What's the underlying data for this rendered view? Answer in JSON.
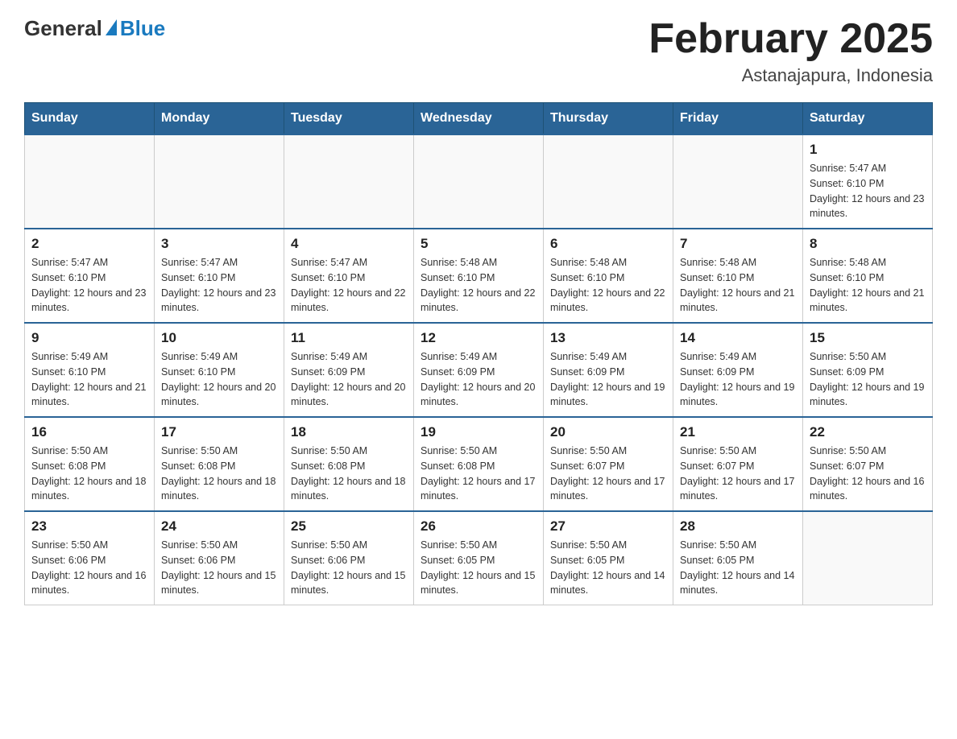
{
  "header": {
    "logo_general": "General",
    "logo_blue": "Blue",
    "title": "February 2025",
    "subtitle": "Astanajapura, Indonesia"
  },
  "weekdays": [
    "Sunday",
    "Monday",
    "Tuesday",
    "Wednesday",
    "Thursday",
    "Friday",
    "Saturday"
  ],
  "weeks": [
    [
      {
        "day": "",
        "sunrise": "",
        "sunset": "",
        "daylight": ""
      },
      {
        "day": "",
        "sunrise": "",
        "sunset": "",
        "daylight": ""
      },
      {
        "day": "",
        "sunrise": "",
        "sunset": "",
        "daylight": ""
      },
      {
        "day": "",
        "sunrise": "",
        "sunset": "",
        "daylight": ""
      },
      {
        "day": "",
        "sunrise": "",
        "sunset": "",
        "daylight": ""
      },
      {
        "day": "",
        "sunrise": "",
        "sunset": "",
        "daylight": ""
      },
      {
        "day": "1",
        "sunrise": "Sunrise: 5:47 AM",
        "sunset": "Sunset: 6:10 PM",
        "daylight": "Daylight: 12 hours and 23 minutes."
      }
    ],
    [
      {
        "day": "2",
        "sunrise": "Sunrise: 5:47 AM",
        "sunset": "Sunset: 6:10 PM",
        "daylight": "Daylight: 12 hours and 23 minutes."
      },
      {
        "day": "3",
        "sunrise": "Sunrise: 5:47 AM",
        "sunset": "Sunset: 6:10 PM",
        "daylight": "Daylight: 12 hours and 23 minutes."
      },
      {
        "day": "4",
        "sunrise": "Sunrise: 5:47 AM",
        "sunset": "Sunset: 6:10 PM",
        "daylight": "Daylight: 12 hours and 22 minutes."
      },
      {
        "day": "5",
        "sunrise": "Sunrise: 5:48 AM",
        "sunset": "Sunset: 6:10 PM",
        "daylight": "Daylight: 12 hours and 22 minutes."
      },
      {
        "day": "6",
        "sunrise": "Sunrise: 5:48 AM",
        "sunset": "Sunset: 6:10 PM",
        "daylight": "Daylight: 12 hours and 22 minutes."
      },
      {
        "day": "7",
        "sunrise": "Sunrise: 5:48 AM",
        "sunset": "Sunset: 6:10 PM",
        "daylight": "Daylight: 12 hours and 21 minutes."
      },
      {
        "day": "8",
        "sunrise": "Sunrise: 5:48 AM",
        "sunset": "Sunset: 6:10 PM",
        "daylight": "Daylight: 12 hours and 21 minutes."
      }
    ],
    [
      {
        "day": "9",
        "sunrise": "Sunrise: 5:49 AM",
        "sunset": "Sunset: 6:10 PM",
        "daylight": "Daylight: 12 hours and 21 minutes."
      },
      {
        "day": "10",
        "sunrise": "Sunrise: 5:49 AM",
        "sunset": "Sunset: 6:10 PM",
        "daylight": "Daylight: 12 hours and 20 minutes."
      },
      {
        "day": "11",
        "sunrise": "Sunrise: 5:49 AM",
        "sunset": "Sunset: 6:09 PM",
        "daylight": "Daylight: 12 hours and 20 minutes."
      },
      {
        "day": "12",
        "sunrise": "Sunrise: 5:49 AM",
        "sunset": "Sunset: 6:09 PM",
        "daylight": "Daylight: 12 hours and 20 minutes."
      },
      {
        "day": "13",
        "sunrise": "Sunrise: 5:49 AM",
        "sunset": "Sunset: 6:09 PM",
        "daylight": "Daylight: 12 hours and 19 minutes."
      },
      {
        "day": "14",
        "sunrise": "Sunrise: 5:49 AM",
        "sunset": "Sunset: 6:09 PM",
        "daylight": "Daylight: 12 hours and 19 minutes."
      },
      {
        "day": "15",
        "sunrise": "Sunrise: 5:50 AM",
        "sunset": "Sunset: 6:09 PM",
        "daylight": "Daylight: 12 hours and 19 minutes."
      }
    ],
    [
      {
        "day": "16",
        "sunrise": "Sunrise: 5:50 AM",
        "sunset": "Sunset: 6:08 PM",
        "daylight": "Daylight: 12 hours and 18 minutes."
      },
      {
        "day": "17",
        "sunrise": "Sunrise: 5:50 AM",
        "sunset": "Sunset: 6:08 PM",
        "daylight": "Daylight: 12 hours and 18 minutes."
      },
      {
        "day": "18",
        "sunrise": "Sunrise: 5:50 AM",
        "sunset": "Sunset: 6:08 PM",
        "daylight": "Daylight: 12 hours and 18 minutes."
      },
      {
        "day": "19",
        "sunrise": "Sunrise: 5:50 AM",
        "sunset": "Sunset: 6:08 PM",
        "daylight": "Daylight: 12 hours and 17 minutes."
      },
      {
        "day": "20",
        "sunrise": "Sunrise: 5:50 AM",
        "sunset": "Sunset: 6:07 PM",
        "daylight": "Daylight: 12 hours and 17 minutes."
      },
      {
        "day": "21",
        "sunrise": "Sunrise: 5:50 AM",
        "sunset": "Sunset: 6:07 PM",
        "daylight": "Daylight: 12 hours and 17 minutes."
      },
      {
        "day": "22",
        "sunrise": "Sunrise: 5:50 AM",
        "sunset": "Sunset: 6:07 PM",
        "daylight": "Daylight: 12 hours and 16 minutes."
      }
    ],
    [
      {
        "day": "23",
        "sunrise": "Sunrise: 5:50 AM",
        "sunset": "Sunset: 6:06 PM",
        "daylight": "Daylight: 12 hours and 16 minutes."
      },
      {
        "day": "24",
        "sunrise": "Sunrise: 5:50 AM",
        "sunset": "Sunset: 6:06 PM",
        "daylight": "Daylight: 12 hours and 15 minutes."
      },
      {
        "day": "25",
        "sunrise": "Sunrise: 5:50 AM",
        "sunset": "Sunset: 6:06 PM",
        "daylight": "Daylight: 12 hours and 15 minutes."
      },
      {
        "day": "26",
        "sunrise": "Sunrise: 5:50 AM",
        "sunset": "Sunset: 6:05 PM",
        "daylight": "Daylight: 12 hours and 15 minutes."
      },
      {
        "day": "27",
        "sunrise": "Sunrise: 5:50 AM",
        "sunset": "Sunset: 6:05 PM",
        "daylight": "Daylight: 12 hours and 14 minutes."
      },
      {
        "day": "28",
        "sunrise": "Sunrise: 5:50 AM",
        "sunset": "Sunset: 6:05 PM",
        "daylight": "Daylight: 12 hours and 14 minutes."
      },
      {
        "day": "",
        "sunrise": "",
        "sunset": "",
        "daylight": ""
      }
    ]
  ]
}
